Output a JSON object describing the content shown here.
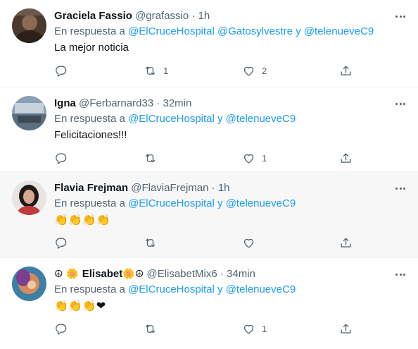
{
  "tweets": [
    {
      "name": "Graciela Fassio",
      "handle": "@grafassio",
      "dot": "·",
      "time": "1h",
      "reply_prefix": "En respuesta a ",
      "reply_links": [
        "@ElCruceHospital",
        "@Gatosylvestre",
        "@telenueveC9"
      ],
      "reply_sep_1": " ",
      "reply_sep_2": " y ",
      "text": "La mejor noticia",
      "retweets": "1",
      "likes": "2"
    },
    {
      "name": "Igna",
      "handle": "@Ferbarnard33",
      "dot": "·",
      "time": "32min",
      "reply_prefix": "En respuesta a ",
      "reply_links": [
        "@ElCruceHospital",
        "@telenueveC9"
      ],
      "reply_sep_1": " y ",
      "text": "Felicitaciones!!!",
      "retweets": "",
      "likes": "1"
    },
    {
      "name": "Flavia Frejman",
      "handle": "@FlaviaFrejman",
      "dot": "·",
      "time": "1h",
      "reply_prefix": "En respuesta a ",
      "reply_links": [
        "@ElCruceHospital",
        "@telenueveC9"
      ],
      "reply_sep_1": " y ",
      "text": "👏👏👏👏",
      "retweets": "",
      "likes": ""
    },
    {
      "name_prefix": "☮ 🌼 ",
      "name": "Elisabet",
      "name_suffix": "🌼☮",
      "handle": "@ElisabetMix6",
      "dot": "·",
      "time": "34min",
      "reply_prefix": "En respuesta a ",
      "reply_links": [
        "@ElCruceHospital",
        "@telenueveC9"
      ],
      "reply_sep_1": " y ",
      "text": "👏👏👏❤",
      "retweets": "",
      "likes": "1"
    }
  ],
  "icons": {
    "reply": "reply-icon",
    "retweet": "retweet-icon",
    "like": "heart-icon",
    "share": "share-icon",
    "more": "more-icon"
  },
  "colors": {
    "link": "#1d9bf0",
    "secondary": "#536471",
    "primary": "#0f1419",
    "highlight_bg": "#f7f7f7"
  }
}
